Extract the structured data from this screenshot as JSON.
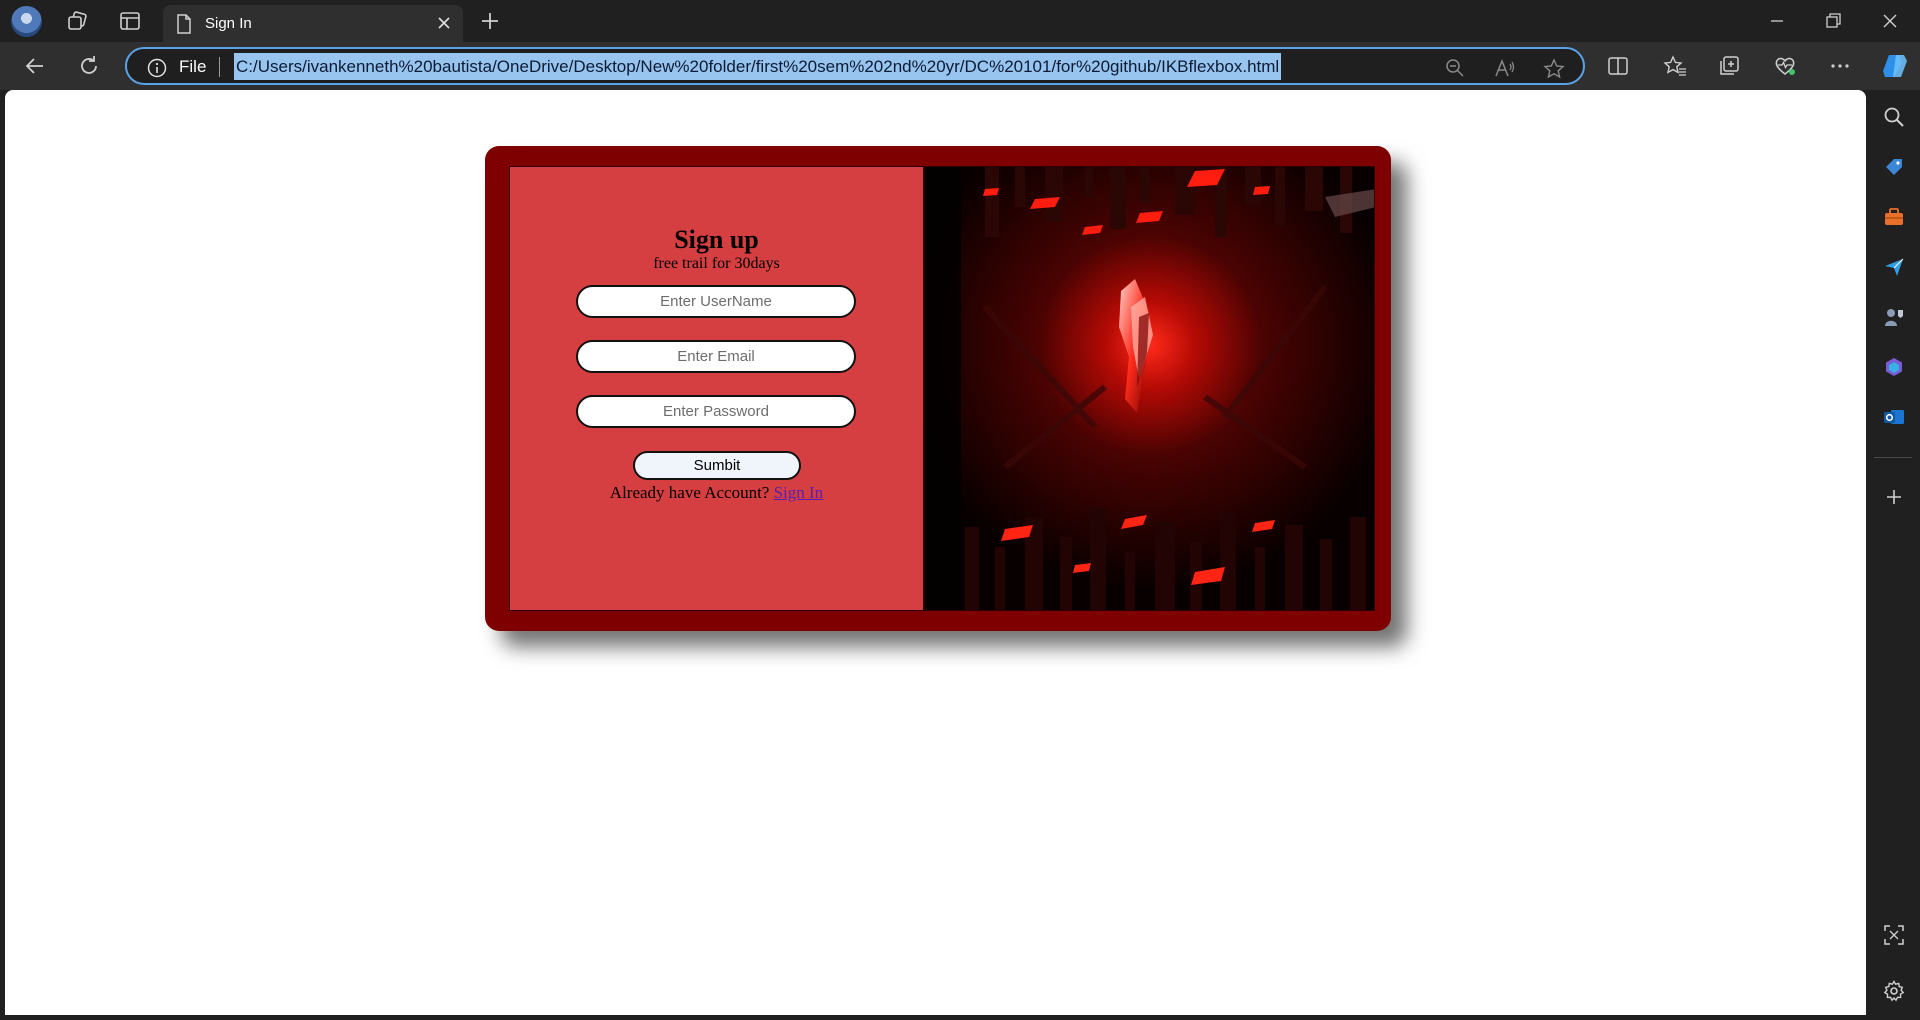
{
  "browser": {
    "tab": {
      "title": "Sign In"
    },
    "address_bar": {
      "scheme_label": "File",
      "url": "C:/Users/ivankenneth%20bautista/OneDrive/Desktop/New%20folder/first%20sem%202nd%20yr/DC%20101/for%20github/IKBflexbox.html"
    },
    "accent_color": "#5aa2e6"
  },
  "page": {
    "form": {
      "title": "Sign up",
      "subtitle": "free trail for 30days",
      "username_placeholder": "Enter UserName",
      "email_placeholder": "Enter Email",
      "password_placeholder": "Enter Password",
      "submit_label": "Sumbit",
      "account_prompt": "Already have Account?",
      "signin_link": "Sign In"
    },
    "colors": {
      "card_border": "#7e0000",
      "form_background": "#d53f41",
      "link": "#5a1fb0"
    }
  },
  "icons": {
    "titlebar": [
      "profile-avatar",
      "workspaces-icon",
      "tab-actions-icon",
      "page-icon",
      "close-icon",
      "plus-icon",
      "minimize-icon",
      "restore-icon",
      "close-window-icon"
    ],
    "toolbar": [
      "back-icon",
      "refresh-icon",
      "info-icon",
      "zoom-out-icon",
      "read-aloud-icon",
      "favorite-star-icon",
      "split-screen-icon",
      "favorites-icon",
      "collections-icon",
      "performance-icon",
      "more-icon",
      "copilot-icon"
    ],
    "sidebar": [
      "search-icon",
      "shopping-icon",
      "tools-icon",
      "send-icon",
      "games-icon",
      "microsoft365-icon",
      "outlook-icon",
      "add-icon",
      "screenshot-icon",
      "settings-icon"
    ]
  }
}
